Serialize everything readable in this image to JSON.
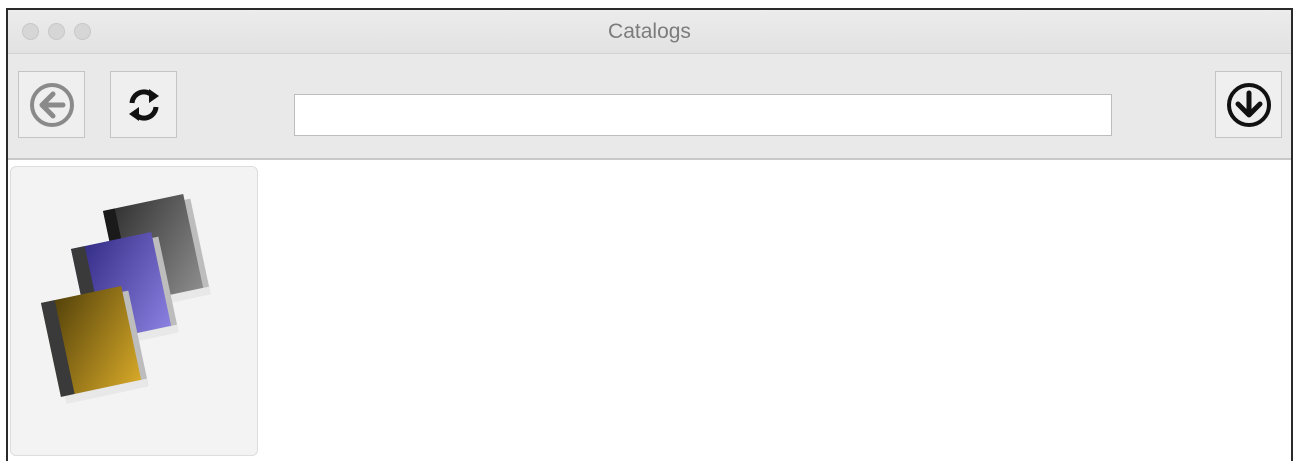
{
  "window": {
    "title": "Catalogs"
  },
  "toolbar": {
    "back_icon": "arrow-left-circle-icon",
    "refresh_icon": "refresh-icon",
    "download_icon": "arrow-down-circle-icon",
    "search": {
      "value": "",
      "placeholder": ""
    }
  },
  "catalogs": [
    {
      "icon": "books-stack-icon",
      "colors": [
        "#6a5fc0",
        "#b8901a",
        "#4a4a4a"
      ]
    }
  ]
}
